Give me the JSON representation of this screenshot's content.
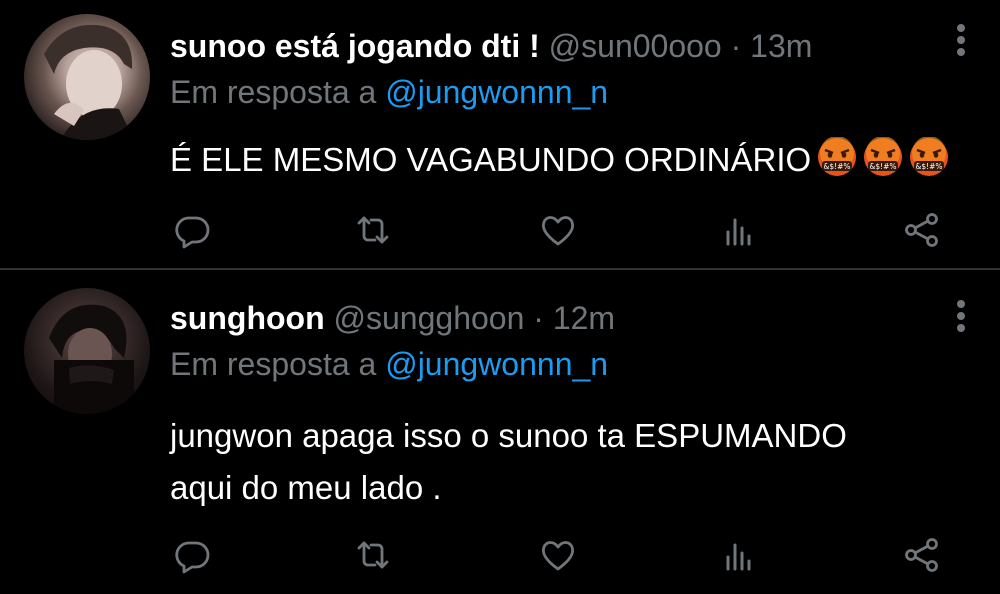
{
  "tweets": [
    {
      "display_name": "sunoo está jogando dti !",
      "handle": "@sun00ooo",
      "separator": "·",
      "time": "13m",
      "reply_prefix": "Em resposta a",
      "reply_to": "@jungwonnn_n",
      "text": "É ELE MESMO VAGABUNDO ORDINÁRIO",
      "emoji": [
        "face-with-symbols-on-mouth",
        "face-with-symbols-on-mouth",
        "face-with-symbols-on-mouth"
      ],
      "emoji_text": "&$!#%"
    },
    {
      "display_name": "sunghoon",
      "handle": "@sungghoon",
      "separator": "·",
      "time": "12m",
      "reply_prefix": "Em resposta a",
      "reply_to": "@jungwonnn_n",
      "text": "jungwon apaga isso o sunoo ta ESPUMANDO\naqui do meu lado ."
    }
  ],
  "icons": [
    "reply-icon",
    "retweet-icon",
    "like-icon",
    "views-icon",
    "share-icon",
    "more-icon"
  ],
  "colors": {
    "background": "#000000",
    "text": "#ffffff",
    "muted": "#71767b",
    "link": "#1d9bf0",
    "divider": "#2f3336"
  }
}
